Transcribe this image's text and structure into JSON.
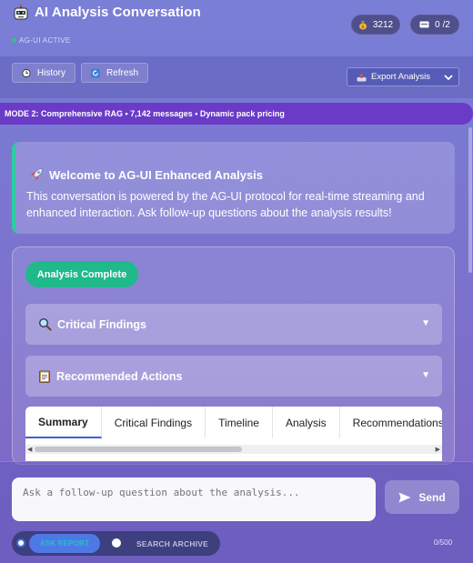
{
  "header": {
    "title": "AI Analysis Conversation",
    "status": "AG-UI ACTIVE",
    "coins": "3212",
    "messages": "0 /2",
    "logo_icon": "robot-icon",
    "coin_icon": "coin-bag-icon",
    "message_icon": "chat-icon"
  },
  "toolbar": {
    "history_label": "History",
    "refresh_label": "Refresh",
    "export_label": "Export Analysis"
  },
  "mode_banner": "MODE 2: Comprehensive RAG • 7,142 messages • Dynamic pack pricing",
  "welcome": {
    "title": "Welcome to AG-UI Enhanced Analysis",
    "body": "This conversation is powered by the AG-UI protocol for real-time streaming and enhanced interaction. Ask follow-up questions about the analysis results!"
  },
  "analysis": {
    "badge": "Analysis Complete",
    "sections": [
      {
        "label": "Critical Findings",
        "icon": "magnifier-icon"
      },
      {
        "label": "Recommended Actions",
        "icon": "clipboard-icon"
      }
    ],
    "tabs": [
      "Summary",
      "Critical Findings",
      "Timeline",
      "Analysis",
      "Recommendations"
    ],
    "active_tab": "Summary"
  },
  "footer": {
    "input_placeholder": "Ask a follow-up question about the analysis...",
    "send_label": "Send",
    "option_ask": "ASK REPORT",
    "option_search": "SEARCH ARCHIVE",
    "char_count": "0/500"
  },
  "colors": {
    "accent_green": "#1fb98a",
    "mode_banner": "#6a3bc7",
    "active_tab_underline": "#3f5fd0"
  }
}
